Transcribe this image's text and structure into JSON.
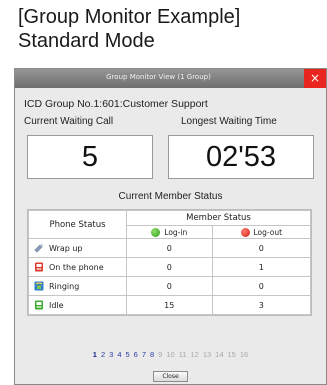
{
  "page": {
    "heading_line1": "[Group Monitor Example]",
    "heading_line2": "Standard Mode"
  },
  "window": {
    "title": "Group Monitor View (1 Group)",
    "close_glyph": "×",
    "close_button_label": "Close"
  },
  "group": {
    "name": "ICD Group No.1:601:Customer Support",
    "waiting_label": "Current Waiting Call",
    "waiting_value": "5",
    "longest_label": "Longest Waiting Time",
    "longest_value": "02'53",
    "member_status_label": "Current Member Status"
  },
  "table": {
    "col_phone_status": "Phone Status",
    "col_member_status": "Member Status",
    "col_login": "Log-in",
    "col_logout": "Log-out",
    "rows": [
      {
        "status": "Wrap up",
        "icon": "wrap-up-icon",
        "login": "0",
        "logout": "0"
      },
      {
        "status": "On the phone",
        "icon": "phone-icon",
        "login": "0",
        "logout": "1"
      },
      {
        "status": "Ringing",
        "icon": "ringing-icon",
        "login": "0",
        "logout": "0"
      },
      {
        "status": "Idle",
        "icon": "idle-icon",
        "login": "15",
        "logout": "3"
      }
    ]
  },
  "pagination": {
    "pages": [
      "1",
      "2",
      "3",
      "4",
      "5",
      "6",
      "7",
      "8",
      "9",
      "10",
      "11",
      "12",
      "13",
      "14",
      "15",
      "16"
    ],
    "current": "1",
    "active_count": 8
  },
  "colors": {
    "title_bar": "#7d7d7d",
    "close_red": "#e8261f",
    "login_green": "#2c9a1a",
    "logout_red": "#d21b12",
    "page_link_blue": "#2b3aa6"
  }
}
